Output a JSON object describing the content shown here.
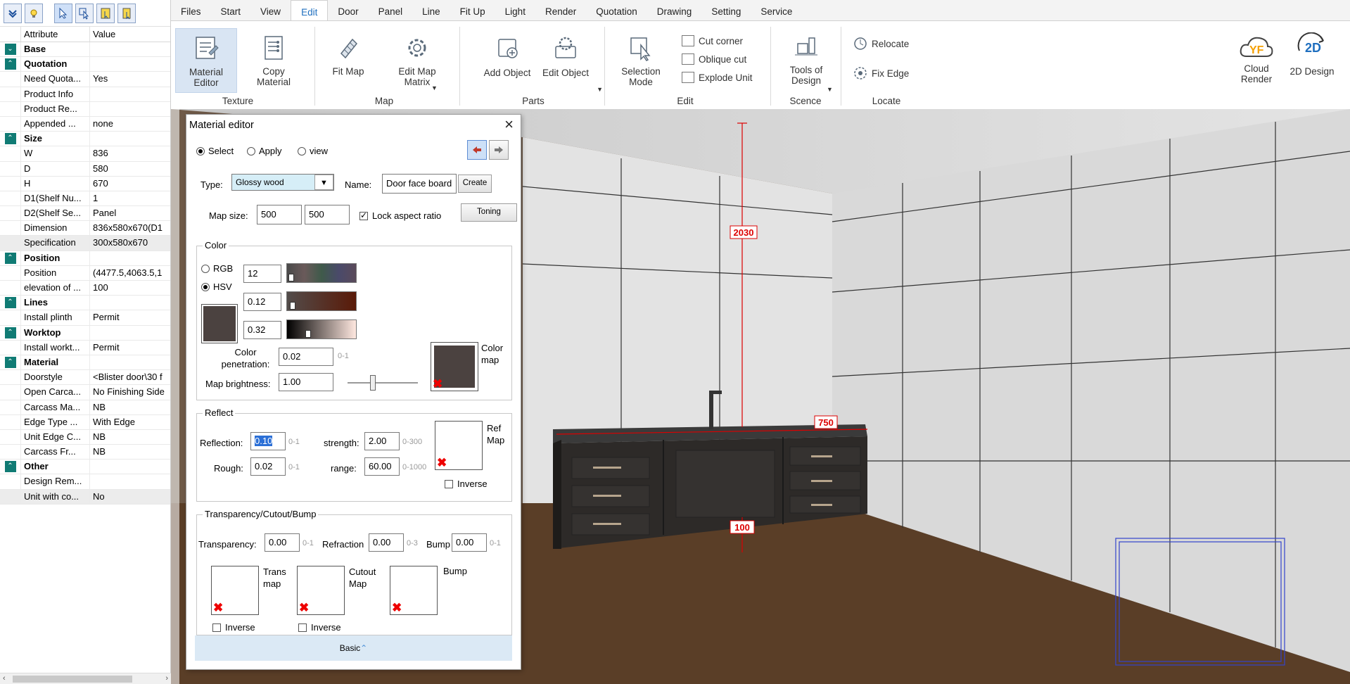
{
  "left_panel": {
    "header": {
      "attribute": "Attribute",
      "value": "Value"
    },
    "rows": [
      {
        "type": "group",
        "label": "Base",
        "icon": "expand-icon"
      },
      {
        "type": "group",
        "label": "Quotation",
        "icon": "collapse-icon"
      },
      {
        "type": "item",
        "label": "Need Quota...",
        "value": "Yes"
      },
      {
        "type": "item",
        "label": "Product Info",
        "value": ""
      },
      {
        "type": "item",
        "label": "Product Re...",
        "value": ""
      },
      {
        "type": "item",
        "label": "Appended ...",
        "value": "none"
      },
      {
        "type": "group",
        "label": "Size",
        "icon": "collapse-icon"
      },
      {
        "type": "item",
        "label": "W",
        "value": "836"
      },
      {
        "type": "item",
        "label": "D",
        "value": "580"
      },
      {
        "type": "item",
        "label": "H",
        "value": "670"
      },
      {
        "type": "item",
        "label": "D1(Shelf Nu...",
        "value": "1"
      },
      {
        "type": "item",
        "label": "D2(Shelf Se...",
        "value": "Panel"
      },
      {
        "type": "item",
        "label": "Dimension",
        "value": "836x580x670(D1"
      },
      {
        "type": "item",
        "label": "Specification",
        "value": "300x580x670",
        "highlight": true
      },
      {
        "type": "group",
        "label": "Position",
        "icon": "collapse-icon"
      },
      {
        "type": "item",
        "label": "Position",
        "value": "(4477.5,4063.5,1"
      },
      {
        "type": "item",
        "label": "elevation of ...",
        "value": "100"
      },
      {
        "type": "group",
        "label": "Lines",
        "icon": "collapse-icon"
      },
      {
        "type": "item",
        "label": "Install plinth",
        "value": "Permit"
      },
      {
        "type": "group",
        "label": "Worktop",
        "icon": "collapse-icon"
      },
      {
        "type": "item",
        "label": "Install workt...",
        "value": "Permit"
      },
      {
        "type": "group",
        "label": "Material",
        "icon": "collapse-icon"
      },
      {
        "type": "item",
        "label": "Doorstyle",
        "value": "<Blister door\\30 f"
      },
      {
        "type": "item",
        "label": "Open Carca...",
        "value": "No Finishing Side"
      },
      {
        "type": "item",
        "label": "Carcass Ma...",
        "value": "NB"
      },
      {
        "type": "item",
        "label": "Edge Type ...",
        "value": "With Edge"
      },
      {
        "type": "item",
        "label": "Unit Edge C...",
        "value": "NB"
      },
      {
        "type": "item",
        "label": "Carcass Fr...",
        "value": "NB"
      },
      {
        "type": "group",
        "label": "Other",
        "icon": "collapse-icon"
      },
      {
        "type": "item",
        "label": "Design Rem...",
        "value": ""
      },
      {
        "type": "item",
        "label": "Unit with co...",
        "value": "No",
        "highlight": true
      }
    ]
  },
  "ribbon": {
    "tabs": [
      "Files",
      "Start",
      "View",
      "Edit",
      "Door",
      "Panel",
      "Line",
      "Fit Up",
      "Light",
      "Render",
      "Quotation",
      "Drawing",
      "Setting",
      "Service"
    ],
    "active_tab": "Edit",
    "buttons": {
      "material_editor": "Material Editor",
      "copy_material": "Copy Material",
      "fit_map": "Fit Map",
      "edit_map_matrix": "Edit Map Matrix",
      "add_object": "Add Object",
      "edit_object": "Edit Object",
      "selection_mode": "Selection Mode",
      "cut_corner": "Cut corner",
      "oblique_cut": "Oblique cut",
      "explode_unit": "Explode Unit",
      "tools_of_design": "Tools of Design",
      "relocate": "Relocate",
      "fix_edge": "Fix Edge",
      "cloud_render": "Cloud Render",
      "design_2d": "2D Design",
      "logo_text": "YF",
      "design_2d_icon_text": "2D"
    },
    "groups": {
      "texture": "Texture",
      "map": "Map",
      "parts": "Parts",
      "edit": "Edit",
      "scence": "Scence",
      "locate": "Locate"
    }
  },
  "viewport": {
    "dimensions": {
      "height": "2030",
      "width": "750",
      "elevation": "100"
    }
  },
  "material_editor": {
    "title": "Material editor",
    "mode_options": [
      "Select",
      "Apply",
      "view"
    ],
    "mode_selected": "Select",
    "type_label": "Type:",
    "type_value": "Glossy wood",
    "name_label": "Name:",
    "name_value": "Door face board",
    "create_label": "Create",
    "map_size_label": "Map size:",
    "map_w": "500",
    "map_h": "500",
    "lock_aspect_label": "Lock aspect ratio",
    "lock_aspect_checked": true,
    "toning_label": "Toning",
    "color": {
      "section": "Color",
      "rgb_label": "RGB",
      "hsv_label": "HSV",
      "selected": "HSV",
      "v1": "12",
      "v2": "0.12",
      "v3": "0.32",
      "swatch": "#4b4240",
      "penetration_label": "Color penetration:",
      "penetration_value": "0.02",
      "penetration_range": "0-1",
      "map_brightness_label": "Map brightness:",
      "map_brightness_value": "1.00",
      "color_map_label": "Color map"
    },
    "reflect": {
      "section": "Reflect",
      "reflection_label": "Reflection:",
      "reflection_value": "0.10",
      "reflection_range": "0-1",
      "strength_label": "strength:",
      "strength_value": "2.00",
      "strength_range": "0-300",
      "rough_label": "Rough:",
      "rough_value": "0.02",
      "rough_range": "0-1",
      "range_label": "range:",
      "range_value": "60.00",
      "range_range": "0-1000",
      "ref_map_label": "Ref Map",
      "inverse_label": "Inverse"
    },
    "transparency": {
      "section": "Transparency/Cutout/Bump",
      "transparency_label": "Transparency:",
      "transparency_value": "0.00",
      "transparency_range": "0-1",
      "refraction_label": "Refraction",
      "refraction_value": "0.00",
      "refraction_range": "0-3",
      "bump_label": "Bump",
      "bump_value": "0.00",
      "bump_range": "0-1",
      "trans_map_label": "Trans map",
      "cutout_map_label": "Cutout Map",
      "bump_map_label": "Bump",
      "inverse_label": "Inverse"
    },
    "footer_label": "Basic"
  }
}
